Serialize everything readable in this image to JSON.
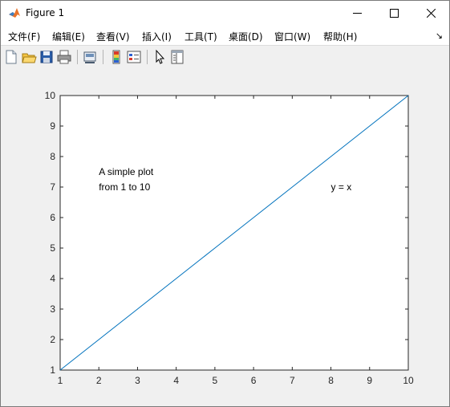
{
  "window": {
    "title": "Figure 1"
  },
  "menu": {
    "items": [
      {
        "label": "文件(F)"
      },
      {
        "label": "编辑(E)"
      },
      {
        "label": "查看(V)"
      },
      {
        "label": "插入(I)"
      },
      {
        "label": "工具(T)"
      },
      {
        "label": "桌面(D)"
      },
      {
        "label": "窗口(W)"
      },
      {
        "label": "帮助(H)"
      }
    ]
  },
  "toolbar": {
    "icons": [
      "new-figure-icon",
      "open-file-icon",
      "save-icon",
      "print-icon",
      "link-plot-icon",
      "insert-colorbar-icon",
      "insert-legend-icon",
      "edit-plot-arrow-icon",
      "property-inspector-icon"
    ]
  },
  "chart_data": {
    "type": "line",
    "title": "",
    "xlabel": "",
    "ylabel": "",
    "xlim": [
      1,
      10
    ],
    "ylim": [
      1,
      10
    ],
    "xticks": [
      "1",
      "2",
      "3",
      "4",
      "5",
      "6",
      "7",
      "8",
      "9",
      "10"
    ],
    "yticks": [
      "1",
      "2",
      "3",
      "4",
      "5",
      "6",
      "7",
      "8",
      "9",
      "10"
    ],
    "grid": false,
    "series": [
      {
        "x": [
          1,
          2,
          3,
          4,
          5,
          6,
          7,
          8,
          9,
          10
        ],
        "y": [
          1,
          2,
          3,
          4,
          5,
          6,
          7,
          8,
          9,
          10
        ],
        "color": "#0072bd"
      }
    ],
    "annotations": [
      {
        "lines": [
          "A simple plot",
          "from 1 to 10"
        ],
        "x": 2,
        "y": 7.5
      },
      {
        "lines": [
          "y = x"
        ],
        "x": 8,
        "y": 7
      }
    ]
  },
  "colors": {
    "line": "#0072bd",
    "figure_bg": "#f0f0f0",
    "axes_bg": "#ffffff"
  }
}
